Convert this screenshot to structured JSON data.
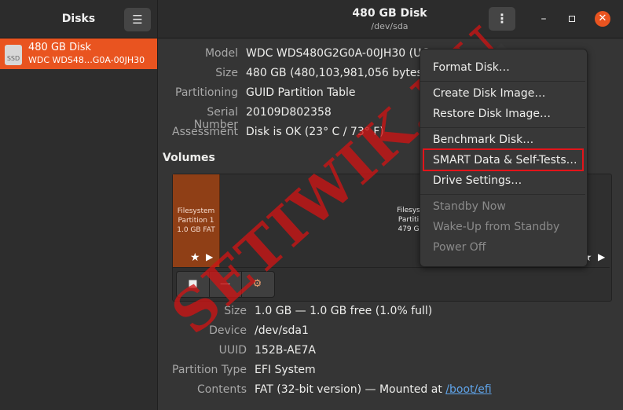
{
  "app": {
    "title": "Disks",
    "menu_icon": "hamburger-icon"
  },
  "window": {
    "title": "480 GB Disk",
    "subtitle": "/dev/sda",
    "kebab_icon": "kebab-icon",
    "minimize_glyph": "–",
    "close_glyph": "✕"
  },
  "sidebar": {
    "items": [
      {
        "icon_text": "SSD",
        "name": "480 GB Disk",
        "model": "WDC WDS48…G0A-00JH30"
      }
    ]
  },
  "disk_info": {
    "model_label": "Model",
    "model_value": "WDC WDS480G2G0A-00JH30 (UG",
    "size_label": "Size",
    "size_value": "480 GB (480,103,981,056 bytes)",
    "partitioning_label": "Partitioning",
    "partitioning_value": "GUID Partition Table",
    "serial_label": "Serial Number",
    "serial_value": "20109D802358",
    "assessment_label": "Assessment",
    "assessment_value": "Disk is OK (23° C / 73° F)"
  },
  "volumes": {
    "heading": "Volumes",
    "partitions": [
      {
        "line1": "Filesystem",
        "line2": "Partition 1",
        "line3": "1.0 GB FAT"
      },
      {
        "line1": "Filesys",
        "line2": "Partiti",
        "line3": "479 G"
      }
    ],
    "star_glyph": "★",
    "play_glyph": "▶",
    "toolbar": {
      "stop_glyph": "■",
      "minus_glyph": "—",
      "gears_glyph": "⚙"
    }
  },
  "partition_info": {
    "size_label": "Size",
    "size_value": "1.0 GB — 1.0 GB free (1.0% full)",
    "device_label": "Device",
    "device_value": "/dev/sda1",
    "uuid_label": "UUID",
    "uuid_value": "152B-AE7A",
    "type_label": "Partition Type",
    "type_value": "EFI System",
    "contents_label": "Contents",
    "contents_value": "FAT (32-bit version) — Mounted at ",
    "contents_link": "/boot/efi"
  },
  "menu": {
    "items": [
      {
        "label": "Format Disk…",
        "enabled": true
      },
      {
        "label": "Create Disk Image…",
        "enabled": true
      },
      {
        "label": "Restore Disk Image…",
        "enabled": true
      },
      {
        "label": "Benchmark Disk…",
        "enabled": true
      },
      {
        "label": "SMART Data & Self-Tests…",
        "enabled": true
      },
      {
        "label": "Drive Settings…",
        "enabled": true
      },
      {
        "label": "Standby Now",
        "enabled": false
      },
      {
        "label": "Wake-Up from Standby",
        "enabled": false
      },
      {
        "label": "Power Off",
        "enabled": false
      }
    ]
  },
  "watermark": {
    "text": "SETIWIK.RU"
  },
  "colors": {
    "accent": "#e95420",
    "highlight_box": "#e2141a",
    "partition": "#8f3f16",
    "link": "#5fa3e8"
  }
}
